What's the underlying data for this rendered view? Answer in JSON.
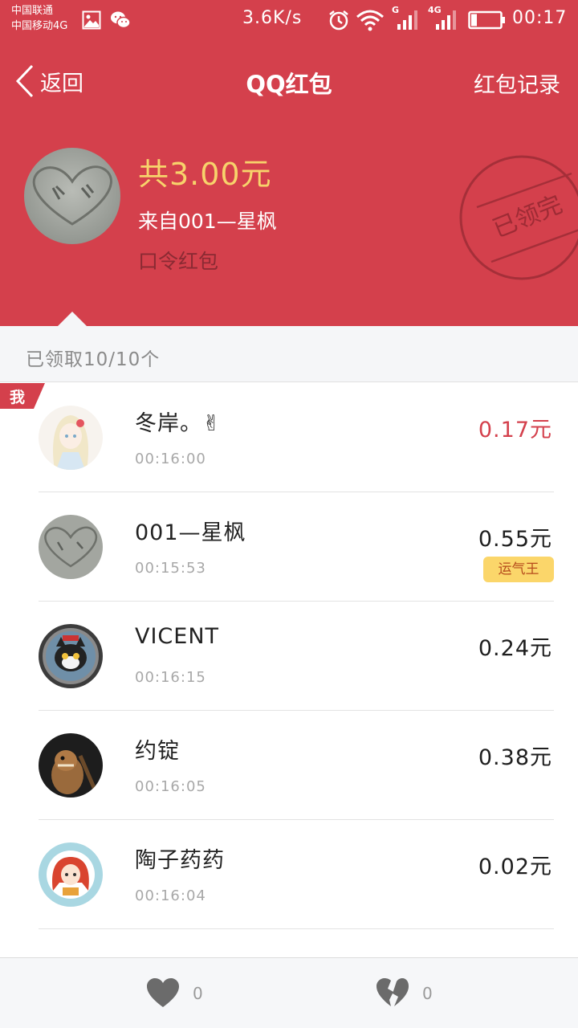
{
  "status_bar": {
    "carrier_1": "中国联通",
    "carrier_2": "中国移动4G",
    "net_speed": "3.6K/s",
    "signal_1_label": "G",
    "signal_2_label": "4G",
    "time": "00:17",
    "icons": [
      "gallery-icon",
      "wechat-icon",
      "alarm-icon",
      "wifi-icon",
      "signal-icon",
      "signal-icon",
      "battery-icon"
    ],
    "battery_level": 0.2
  },
  "nav": {
    "back_label": "返回",
    "title": "QQ红包",
    "records_label": "红包记录"
  },
  "header": {
    "total": "共3.00元",
    "from": "来自001—星枫",
    "type": "口令红包",
    "stamp": "已领完"
  },
  "summary": {
    "count_text": "已领取10/10个"
  },
  "me_tag": "我",
  "recipients": [
    {
      "name": "冬岸。✌",
      "time": "00:16:00",
      "amount": "0.17元",
      "is_me": true
    },
    {
      "name": "001—星枫",
      "time": "00:15:53",
      "amount": "0.55元",
      "badge": "运气王"
    },
    {
      "name": "VICENT",
      "time": "00:16:15",
      "amount": "0.24元"
    },
    {
      "name": "约锭",
      "time": "00:16:05",
      "amount": "0.38元"
    },
    {
      "name": "陶子药药",
      "time": "00:16:04",
      "amount": "0.02元"
    }
  ],
  "bottom": {
    "like_count": "0",
    "dislike_count": "0"
  },
  "colors": {
    "header_red": "#d4404c",
    "gold": "#f7d36b",
    "badge_yellow": "#fbd66a"
  }
}
